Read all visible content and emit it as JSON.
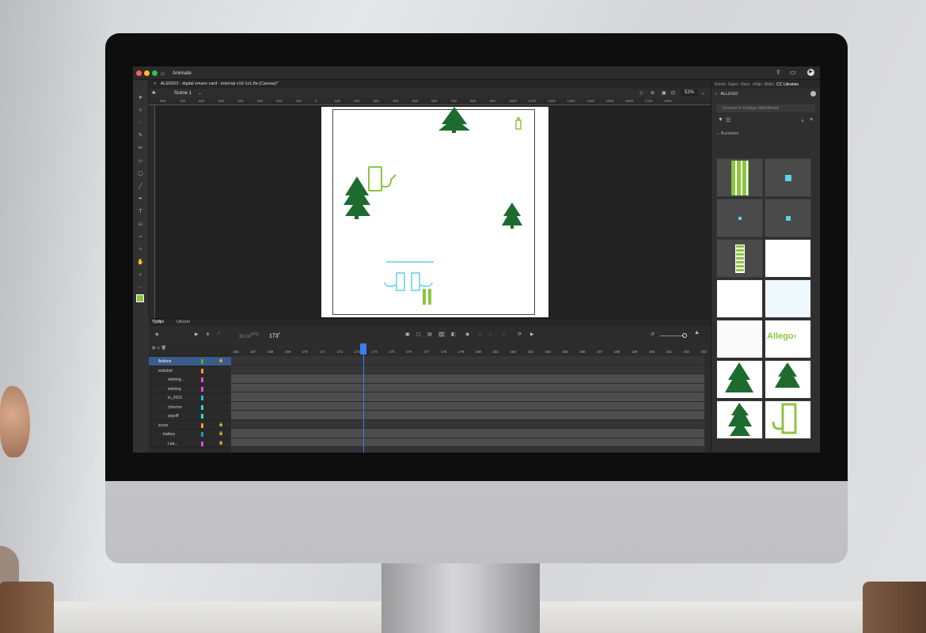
{
  "menubar": {
    "home_icon": "home-icon",
    "app_name": "Animate"
  },
  "document": {
    "tab_title": "ALE0003 - digital xmaxx card - internal v19-1x1.fla (Canvas)*",
    "close": "×"
  },
  "scene": {
    "name": "Scène 1",
    "zoom": "52%"
  },
  "ruler_ticks": [
    "800",
    "700",
    "600",
    "500",
    "400",
    "300",
    "200",
    "100",
    "0",
    "100",
    "200",
    "300",
    "400",
    "500",
    "600",
    "700",
    "800",
    "900",
    "1000",
    "1100",
    "1200",
    "1300",
    "1400",
    "1500",
    "1600",
    "1700",
    "1800"
  ],
  "panel": {
    "tabs": [
      "Eleme",
      "Eigen",
      "Kleur",
      "Uitlijn",
      "Biblio",
      "CC Libraries"
    ],
    "library": "ALLEGO",
    "search_placeholder": "Zoeken in huidige bibliotheek",
    "section": "Illustraties",
    "logo_text": "Allego"
  },
  "timeline": {
    "tabs": [
      "Tijdlijn",
      "Uitvoer"
    ],
    "fps": "30,00",
    "fps_unit": "FPS",
    "frame": "173",
    "frame_unit": "F",
    "frame_numbers": [
      "166",
      "167",
      "168",
      "169",
      "170",
      "171",
      "172",
      "173",
      "174",
      "175",
      "176",
      "177",
      "178",
      "179",
      "180",
      "181",
      "182",
      "183",
      "184",
      "185",
      "186",
      "187",
      "188",
      "189",
      "190",
      "191",
      "192",
      "193"
    ],
    "current_frame_fraction": 0.28,
    "layers": [
      {
        "name": "Actions",
        "color": "#2dbf3a",
        "selected": true,
        "locked": true
      },
      {
        "name": "endshot",
        "color": "#f09a2a",
        "selected": false,
        "locked": false
      },
      {
        "name": "wishing...",
        "color": "#e44bd6",
        "selected": false,
        "locked": false
      },
      {
        "name": "wishing",
        "color": "#e44bd6",
        "selected": false,
        "locked": false
      },
      {
        "name": "in_2023",
        "color": "#2dbfbf",
        "selected": false,
        "locked": false
      },
      {
        "name": "chevron",
        "color": "#2dd6d6",
        "selected": false,
        "locked": false
      },
      {
        "name": "payoff",
        "color": "#2dd6d6",
        "selected": false,
        "locked": false
      },
      {
        "name": "score",
        "color": "#f09a2a",
        "selected": false,
        "locked": true
      },
      {
        "name": "battery",
        "color": "#2d8fbf",
        "selected": false,
        "locked": true
      },
      {
        "name": "Laa...",
        "color": "#e44bd6",
        "selected": false,
        "locked": true
      }
    ]
  },
  "colors": {
    "accent": "#3d7ef0",
    "green_dark": "#1d6b2f",
    "green_lime": "#8cc63f",
    "cyan": "#5fd0e6"
  }
}
